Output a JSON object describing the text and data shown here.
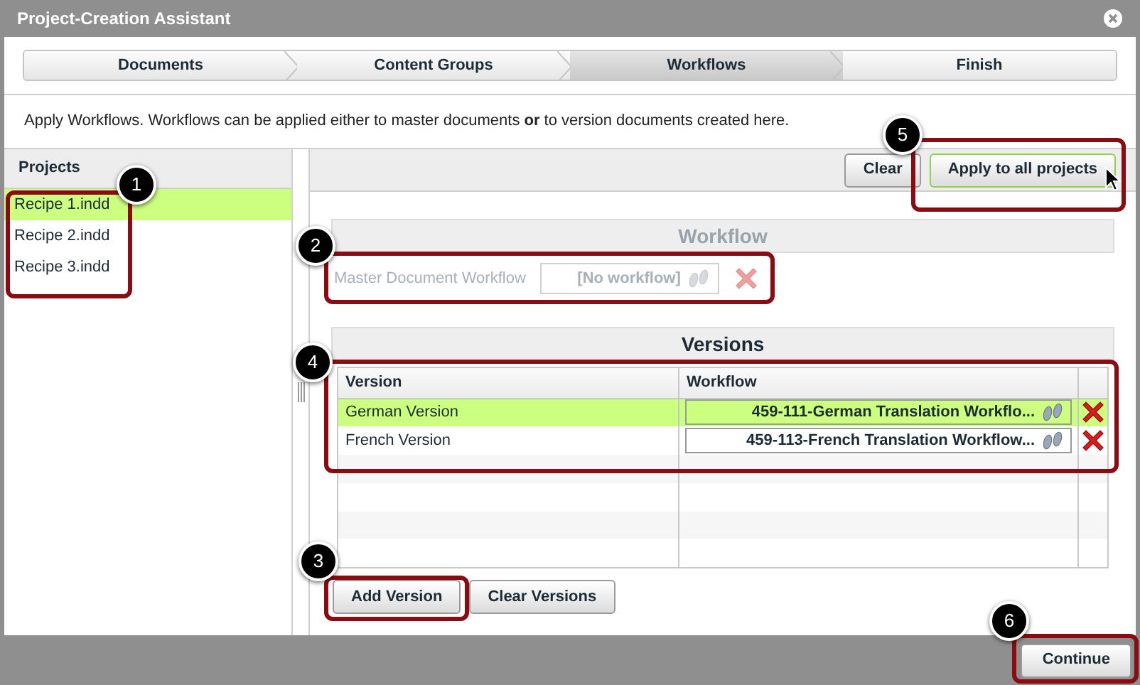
{
  "window": {
    "title": "Project-Creation Assistant"
  },
  "steps": [
    {
      "label": "Documents",
      "selected": false
    },
    {
      "label": "Content Groups",
      "selected": false
    },
    {
      "label": "Workflows",
      "selected": true
    },
    {
      "label": "Finish",
      "selected": false
    }
  ],
  "description": "Apply Workflows. Workflows can be applied either to master documents **or** to version documents created here.",
  "projects": {
    "title": "Projects",
    "items": [
      {
        "label": "Recipe 1.indd",
        "selected": true
      },
      {
        "label": "Recipe 2.indd",
        "selected": false
      },
      {
        "label": "Recipe 3.indd",
        "selected": false
      }
    ]
  },
  "toolbar": {
    "buttons": [
      {
        "label": "Clear",
        "highlighted": false
      },
      {
        "label": "Apply to all projects",
        "highlighted": true
      }
    ]
  },
  "workflow": {
    "title": "Workflow",
    "label": "Master Document Workflow",
    "value": "[No workflow]",
    "disabled": true
  },
  "versions": {
    "title": "Versions",
    "columns": [
      "Version",
      "Workflow"
    ],
    "rows": [
      {
        "version": "German Version",
        "workflow": "459-111-German Translation Workflo...",
        "selected": true
      },
      {
        "version": "French Version",
        "workflow": "459-113-French Translation Workflow...",
        "selected": false
      }
    ],
    "buttons": [
      "Add Version",
      "Clear Versions"
    ]
  },
  "footer": {
    "button": "Continue"
  },
  "callouts": [
    {
      "number": "1"
    },
    {
      "number": "2"
    },
    {
      "number": "3"
    },
    {
      "number": "4"
    },
    {
      "number": "5"
    },
    {
      "number": "6"
    }
  ]
}
